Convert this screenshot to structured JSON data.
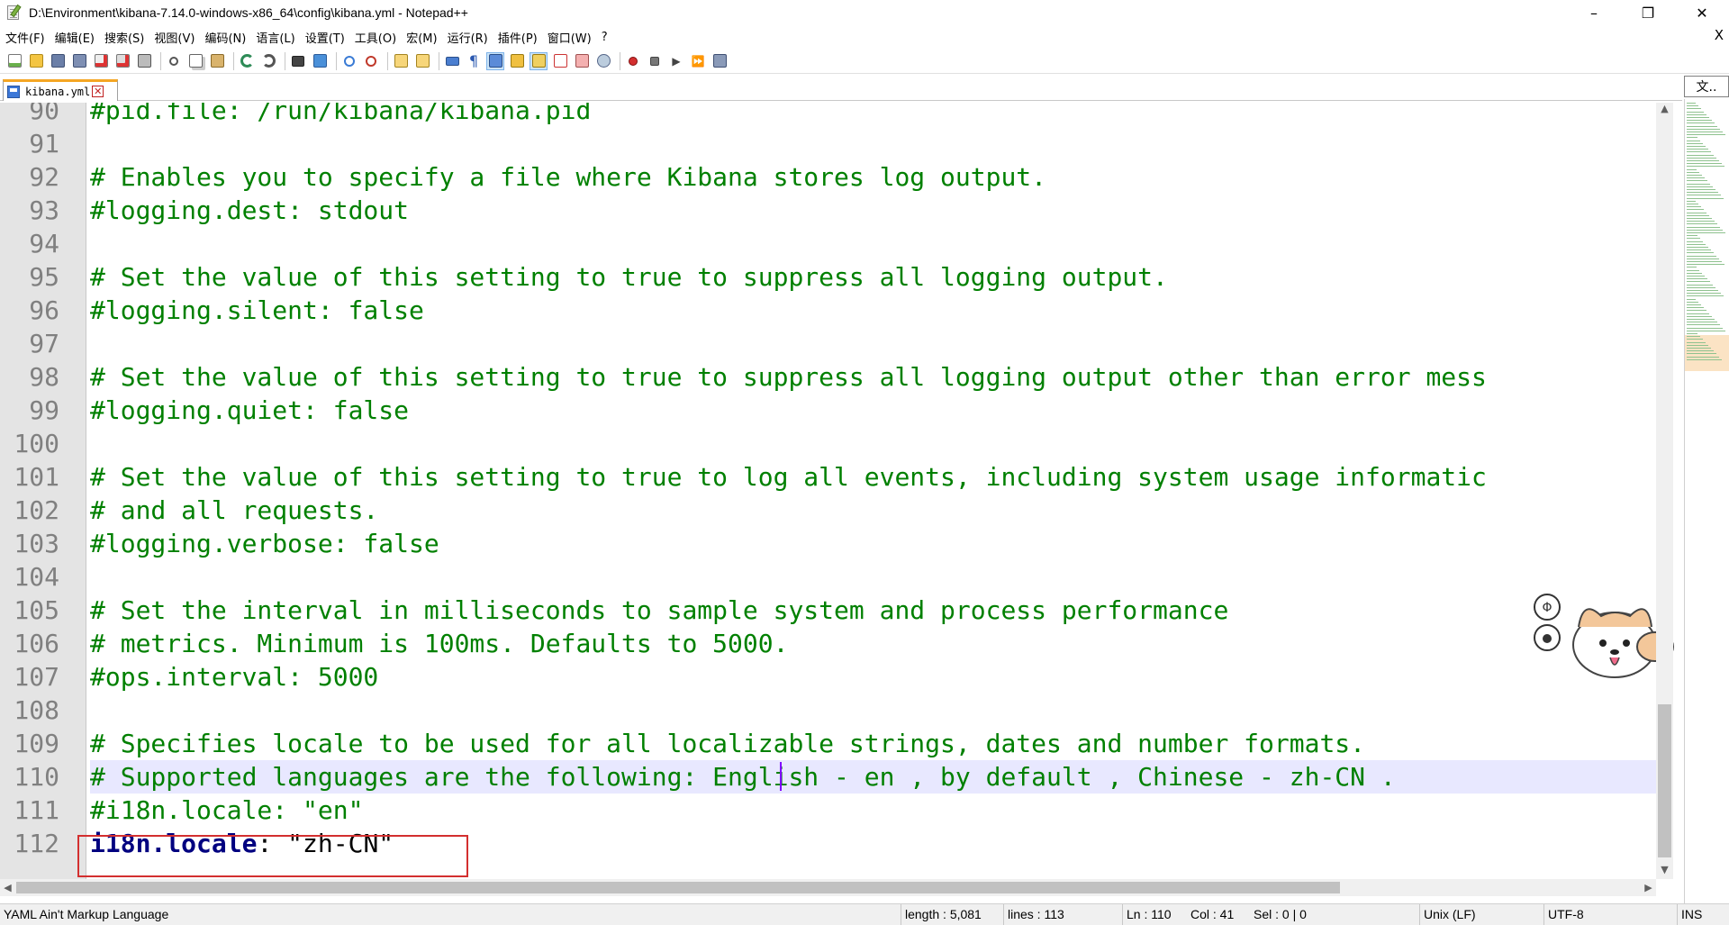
{
  "window": {
    "title": "D:\\Environment\\kibana-7.14.0-windows-x86_64\\config\\kibana.yml - Notepad++",
    "minimize": "–",
    "maximize": "❐",
    "close": "✕"
  },
  "menu": {
    "items": [
      "文件(F)",
      "编辑(E)",
      "搜索(S)",
      "视图(V)",
      "编码(N)",
      "语言(L)",
      "设置(T)",
      "工具(O)",
      "宏(M)",
      "运行(R)",
      "插件(P)",
      "窗口(W)",
      "?"
    ],
    "close": "X"
  },
  "tabs": [
    {
      "label": "kibana.yml",
      "icon": "save-disk-icon"
    }
  ],
  "docmap": {
    "label": "文.."
  },
  "editor": {
    "lines": [
      {
        "n": "90",
        "text": "#pid.file: /run/kibana/kibana.pid"
      },
      {
        "n": "91",
        "text": ""
      },
      {
        "n": "92",
        "text": "# Enables you to specify a file where Kibana stores log output."
      },
      {
        "n": "93",
        "text": "#logging.dest: stdout"
      },
      {
        "n": "94",
        "text": ""
      },
      {
        "n": "95",
        "text": "# Set the value of this setting to true to suppress all logging output."
      },
      {
        "n": "96",
        "text": "#logging.silent: false"
      },
      {
        "n": "97",
        "text": ""
      },
      {
        "n": "98",
        "text": "# Set the value of this setting to true to suppress all logging output other than error mess"
      },
      {
        "n": "99",
        "text": "#logging.quiet: false"
      },
      {
        "n": "100",
        "text": ""
      },
      {
        "n": "101",
        "text": "# Set the value of this setting to true to log all events, including system usage informatic"
      },
      {
        "n": "102",
        "text": "# and all requests."
      },
      {
        "n": "103",
        "text": "#logging.verbose: false"
      },
      {
        "n": "104",
        "text": ""
      },
      {
        "n": "105",
        "text": "# Set the interval in milliseconds to sample system and process performance"
      },
      {
        "n": "106",
        "text": "# metrics. Minimum is 100ms. Defaults to 5000."
      },
      {
        "n": "107",
        "text": "#ops.interval: 5000"
      },
      {
        "n": "108",
        "text": ""
      },
      {
        "n": "109",
        "text": "# Specifies locale to be used for all localizable strings, dates and number formats."
      },
      {
        "n": "110",
        "text": "# Supported languages are the following: English - en , by default , Chinese - zh-CN ."
      },
      {
        "n": "111",
        "text": "#i18n.locale: \"en\""
      },
      {
        "n": "112",
        "key": "i18n.locale",
        "colon": ":",
        "value": " \"zh-CN\""
      }
    ],
    "current_line": "110"
  },
  "status": {
    "language": "YAML Ain't Markup Language",
    "length": "length : 5,081",
    "lines": "lines : 113",
    "ln": "Ln : 110",
    "col": "Col : 41",
    "sel": "Sel : 0 | 0",
    "eol": "Unix (LF)",
    "encoding": "UTF-8",
    "mode": "INS"
  },
  "colors": {
    "comment": "#008000",
    "key": "#000080",
    "current_line": "#e8e8ff",
    "highlight_border": "#d32f2f"
  }
}
